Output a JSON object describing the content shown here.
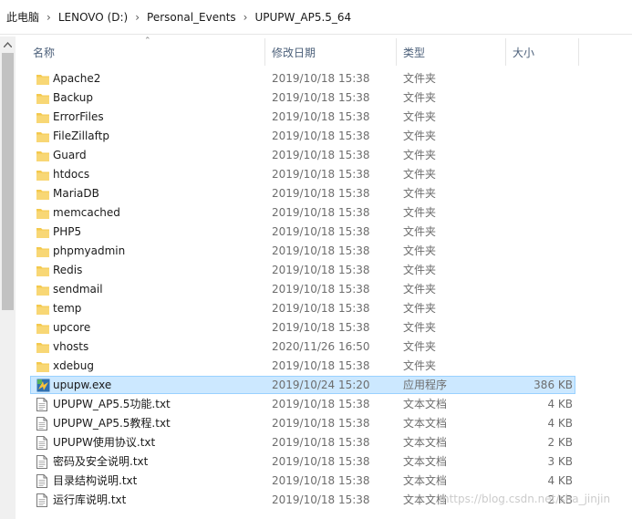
{
  "breadcrumb": [
    "此电脑",
    "LENOVO (D:)",
    "Personal_Events",
    "UPUPW_AP5.5_64"
  ],
  "columns": {
    "name": "名称",
    "date": "修改日期",
    "type": "类型",
    "size": "大小"
  },
  "rows": [
    {
      "icon": "folder-icon",
      "name": "Apache2",
      "date": "2019/10/18 15:38",
      "type": "文件夹",
      "size": ""
    },
    {
      "icon": "folder-icon",
      "name": "Backup",
      "date": "2019/10/18 15:38",
      "type": "文件夹",
      "size": ""
    },
    {
      "icon": "folder-icon",
      "name": "ErrorFiles",
      "date": "2019/10/18 15:38",
      "type": "文件夹",
      "size": ""
    },
    {
      "icon": "folder-icon",
      "name": "FileZillaftp",
      "date": "2019/10/18 15:38",
      "type": "文件夹",
      "size": ""
    },
    {
      "icon": "folder-icon",
      "name": "Guard",
      "date": "2019/10/18 15:38",
      "type": "文件夹",
      "size": ""
    },
    {
      "icon": "folder-icon",
      "name": "htdocs",
      "date": "2019/10/18 15:38",
      "type": "文件夹",
      "size": ""
    },
    {
      "icon": "folder-icon",
      "name": "MariaDB",
      "date": "2019/10/18 15:38",
      "type": "文件夹",
      "size": ""
    },
    {
      "icon": "folder-icon",
      "name": "memcached",
      "date": "2019/10/18 15:38",
      "type": "文件夹",
      "size": ""
    },
    {
      "icon": "folder-icon",
      "name": "PHP5",
      "date": "2019/10/18 15:38",
      "type": "文件夹",
      "size": ""
    },
    {
      "icon": "folder-icon",
      "name": "phpmyadmin",
      "date": "2019/10/18 15:38",
      "type": "文件夹",
      "size": ""
    },
    {
      "icon": "folder-icon",
      "name": "Redis",
      "date": "2019/10/18 15:38",
      "type": "文件夹",
      "size": ""
    },
    {
      "icon": "folder-icon",
      "name": "sendmail",
      "date": "2019/10/18 15:38",
      "type": "文件夹",
      "size": ""
    },
    {
      "icon": "folder-icon",
      "name": "temp",
      "date": "2019/10/18 15:38",
      "type": "文件夹",
      "size": ""
    },
    {
      "icon": "folder-icon",
      "name": "upcore",
      "date": "2019/10/18 15:38",
      "type": "文件夹",
      "size": ""
    },
    {
      "icon": "folder-icon",
      "name": "vhosts",
      "date": "2020/11/26 16:50",
      "type": "文件夹",
      "size": ""
    },
    {
      "icon": "folder-icon",
      "name": "xdebug",
      "date": "2019/10/18 15:38",
      "type": "文件夹",
      "size": ""
    },
    {
      "icon": "exe-icon",
      "name": "upupw.exe",
      "date": "2019/10/24 15:20",
      "type": "应用程序",
      "size": "386 KB",
      "selected": true
    },
    {
      "icon": "text-file-icon",
      "name": "UPUPW_AP5.5功能.txt",
      "date": "2019/10/18 15:38",
      "type": "文本文档",
      "size": "4 KB"
    },
    {
      "icon": "text-file-icon",
      "name": "UPUPW_AP5.5教程.txt",
      "date": "2019/10/18 15:38",
      "type": "文本文档",
      "size": "4 KB"
    },
    {
      "icon": "text-file-icon",
      "name": "UPUPW使用协议.txt",
      "date": "2019/10/18 15:38",
      "type": "文本文档",
      "size": "2 KB"
    },
    {
      "icon": "text-file-icon",
      "name": "密码及安全说明.txt",
      "date": "2019/10/18 15:38",
      "type": "文本文档",
      "size": "3 KB"
    },
    {
      "icon": "text-file-icon",
      "name": "目录结构说明.txt",
      "date": "2019/10/18 15:38",
      "type": "文本文档",
      "size": "4 KB"
    },
    {
      "icon": "text-file-icon",
      "name": "运行库说明.txt",
      "date": "2019/10/18 15:38",
      "type": "文本文档",
      "size": "2 KB"
    }
  ],
  "watermark": "https://blog.csdn.net/sha_jinjin",
  "colors": {
    "folder": "#f4c94d",
    "selection": "#cce8ff",
    "selection_border": "#99d1ff",
    "header_text": "#4c607a"
  }
}
